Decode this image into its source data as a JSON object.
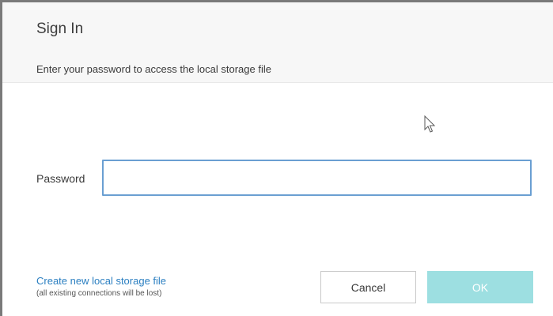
{
  "dialog": {
    "title": "Sign In",
    "subtitle": "Enter your password to access the local storage file"
  },
  "form": {
    "password_label": "Password",
    "password_value": "",
    "password_placeholder": ""
  },
  "footer": {
    "create_link": "Create new local storage file",
    "create_note": "(all existing connections will be lost)",
    "cancel_label": "Cancel",
    "ok_label": "OK"
  },
  "icons": {
    "pointer": "mouse-pointer-icon"
  },
  "colors": {
    "link": "#2b7fc1",
    "ok_button_bg": "#9ddfe1",
    "input_border": "#6a9fd2",
    "header_bg": "#f7f7f7"
  }
}
